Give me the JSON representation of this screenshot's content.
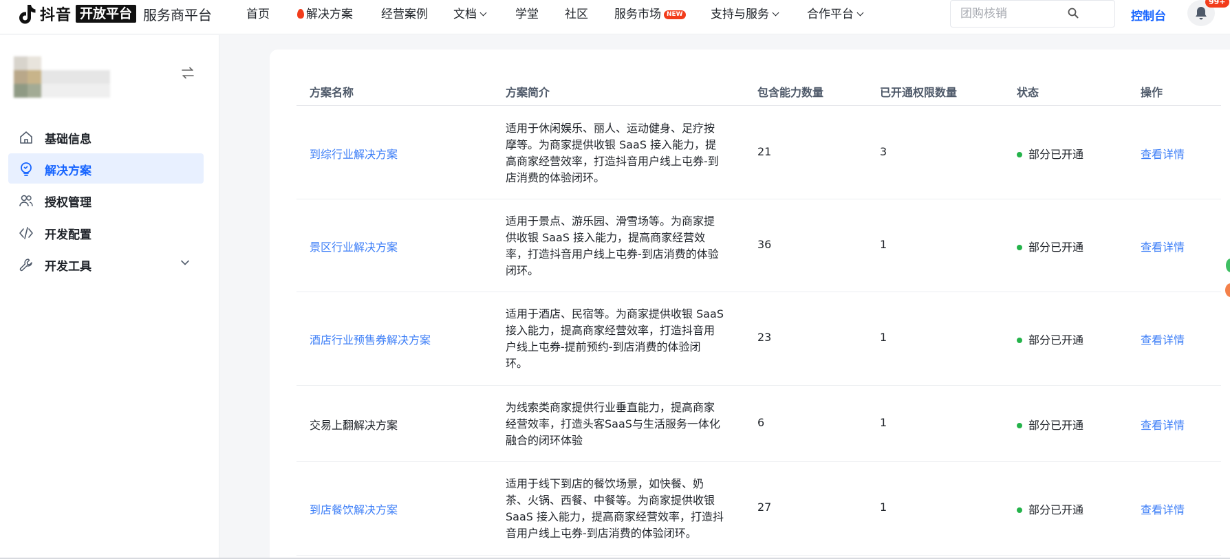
{
  "header": {
    "logo": {
      "brand": "抖音",
      "badge": "开放平台",
      "platform": "服务商平台"
    },
    "nav": [
      {
        "label": "首页"
      },
      {
        "label": "解决方案",
        "flame": true
      },
      {
        "label": "经营案例"
      },
      {
        "label": "文档",
        "dropdown": true
      },
      {
        "label": "学堂"
      },
      {
        "label": "社区"
      },
      {
        "label": "服务市场",
        "badge": "NEW"
      },
      {
        "label": "支持与服务",
        "dropdown": true
      },
      {
        "label": "合作平台",
        "dropdown": true
      }
    ],
    "search": {
      "placeholder": "团购核销",
      "value": ""
    },
    "console_label": "控制台",
    "notification_count": "99+"
  },
  "sidebar": {
    "items": [
      {
        "label": "基础信息",
        "icon": "home-icon",
        "active": false
      },
      {
        "label": "解决方案",
        "icon": "lightbulb-icon",
        "active": true
      },
      {
        "label": "授权管理",
        "icon": "users-icon",
        "active": false
      },
      {
        "label": "开发配置",
        "icon": "code-icon",
        "active": false
      },
      {
        "label": "开发工具",
        "icon": "wrench-icon",
        "active": false,
        "expandable": true
      }
    ]
  },
  "table": {
    "columns": [
      "方案名称",
      "方案简介",
      "包含能力数量",
      "已开通权限数量",
      "状态",
      "操作"
    ],
    "rows": [
      {
        "name": "到综行业解决方案",
        "is_link": true,
        "desc": [
          "适用于休闲娱乐、丽人、运动健身、足疗按",
          "摩等。为商家提供收银 SaaS 接入能力，提",
          "高商家经营效率，打造抖音用户线上屯券-到",
          "店消费的体验闭环。"
        ],
        "capability_count": "21",
        "permission_count": "3",
        "status": "部分已开通",
        "action": "查看详情"
      },
      {
        "name": "景区行业解决方案",
        "is_link": true,
        "desc": [
          "适用于景点、游乐园、滑雪场等。为商家提",
          "供收银 SaaS 接入能力，提高商家经营效",
          "率，打造抖音用户线上屯券-到店消费的体验",
          "闭环。"
        ],
        "capability_count": "36",
        "permission_count": "1",
        "status": "部分已开通",
        "action": "查看详情"
      },
      {
        "name": "酒店行业预售券解决方案",
        "is_link": true,
        "desc": [
          "适用于酒店、民宿等。为商家提供收银 SaaS",
          "接入能力，提高商家经营效率，打造抖音用",
          "户线上屯券-提前预约-到店消费的体验闭",
          "环。"
        ],
        "capability_count": "23",
        "permission_count": "1",
        "status": "部分已开通",
        "action": "查看详情"
      },
      {
        "name": "交易上翻解决方案",
        "is_link": false,
        "desc": [
          "为线索类商家提供行业垂直能力，提高商家",
          "经营效率，打造头客SaaS与生活服务一体化",
          "融合的闭环体验"
        ],
        "capability_count": "6",
        "permission_count": "1",
        "status": "部分已开通",
        "action": "查看详情"
      },
      {
        "name": "到店餐饮解决方案",
        "is_link": true,
        "desc": [
          "适用于线下到店的餐饮场景，如快餐、奶",
          "茶、火锅、西餐、中餐等。为商家提供收银",
          "SaaS 接入能力，提高商家经营效率，打造抖",
          "音用户线上屯券-到店消费的体验闭环。"
        ],
        "capability_count": "27",
        "permission_count": "1",
        "status": "部分已开通",
        "action": "查看详情"
      }
    ]
  },
  "colors": {
    "brand_blue": "#1664ff",
    "link_blue": "#3c7ef7",
    "status_green": "#24b34a",
    "badge_red": "#f23c1b"
  }
}
